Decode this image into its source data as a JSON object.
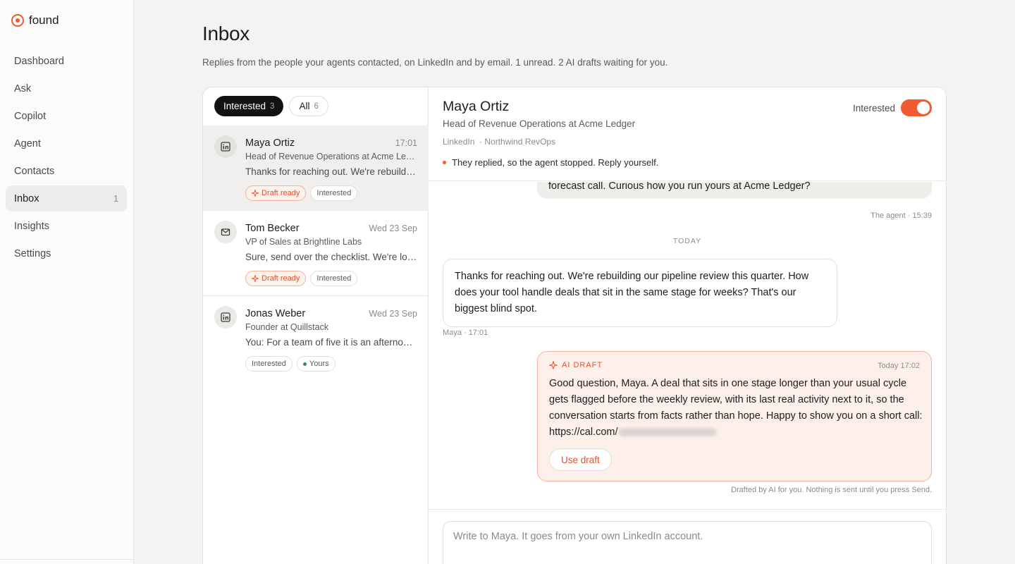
{
  "brand": {
    "name": "found"
  },
  "nav": {
    "items": [
      {
        "label": "Dashboard"
      },
      {
        "label": "Ask"
      },
      {
        "label": "Copilot"
      },
      {
        "label": "Agent"
      },
      {
        "label": "Contacts"
      },
      {
        "label": "Inbox",
        "count": "1",
        "active": true
      },
      {
        "label": "Insights"
      },
      {
        "label": "Settings"
      }
    ]
  },
  "header": {
    "title": "Inbox",
    "subtitle": "Replies from the people your agents contacted, on LinkedIn and by email. 1 unread. 2 AI drafts waiting for you."
  },
  "filters": {
    "interested": {
      "label": "Interested",
      "count": "3"
    },
    "all": {
      "label": "All",
      "count": "6"
    }
  },
  "threads": [
    {
      "name": "Maya Ortiz",
      "time": "17:01",
      "role": "Head of Revenue Operations at Acme Ledger",
      "preview": "Thanks for reaching out. We're rebuilding our pipeline review this quarter.",
      "channel_icon": "linkedin-icon",
      "tags": [
        "Draft ready",
        "Interested"
      ]
    },
    {
      "name": "Tom Becker",
      "time": "Wed 23 Sep",
      "role": "VP of Sales at Brightline Labs",
      "preview": "Sure, send over the checklist. We're looking at this now.",
      "channel_icon": "mail-icon",
      "tags": [
        "Draft ready",
        "Interested"
      ]
    },
    {
      "name": "Jonas Weber",
      "time": "Wed 23 Sep",
      "role": "Founder at Quillstack",
      "preview": "You: For a team of five it is an afternoon of setup.",
      "channel_icon": "linkedin-icon",
      "tags": [
        "Interested",
        "Yours"
      ]
    }
  ],
  "detail": {
    "name": "Maya Ortiz",
    "role": "Head of Revenue Operations at Acme Ledger",
    "channel": "LinkedIn",
    "campaign": "· Northwind RevOps",
    "notice": "They replied, so the agent stopped. Reply yourself.",
    "toggle_label": "Interested",
    "toggle_on": true
  },
  "conversation": {
    "outgoing_text": "forecast call. Curious how you run yours at Acme Ledger?",
    "outgoing_meta": "The agent · 15:39",
    "day_separator": "TODAY",
    "incoming_text": "Thanks for reaching out. We're rebuilding our pipeline review this quarter. How does your tool handle deals that sit in the same stage for weeks? That's our biggest blind spot.",
    "incoming_meta": "Maya · 17:01"
  },
  "ai_draft": {
    "label": "AI DRAFT",
    "time": "Today 17:02",
    "text": "Good question, Maya. A deal that sits in one stage longer than your usual cycle gets flagged before the weekly review, with its last real activity next to it, so the conversation starts from facts rather than hope. Happy to show you on a short call: https://cal.com/",
    "use_button": "Use draft",
    "note": "Drafted by AI for you. Nothing is sent until you press Send."
  },
  "composer": {
    "placeholder": "Write to Maya. It goes from your own LinkedIn account."
  },
  "colors": {
    "accent": "#ef5a2f",
    "draft_bg": "#fdf0eb",
    "active_pill": "#121212"
  }
}
